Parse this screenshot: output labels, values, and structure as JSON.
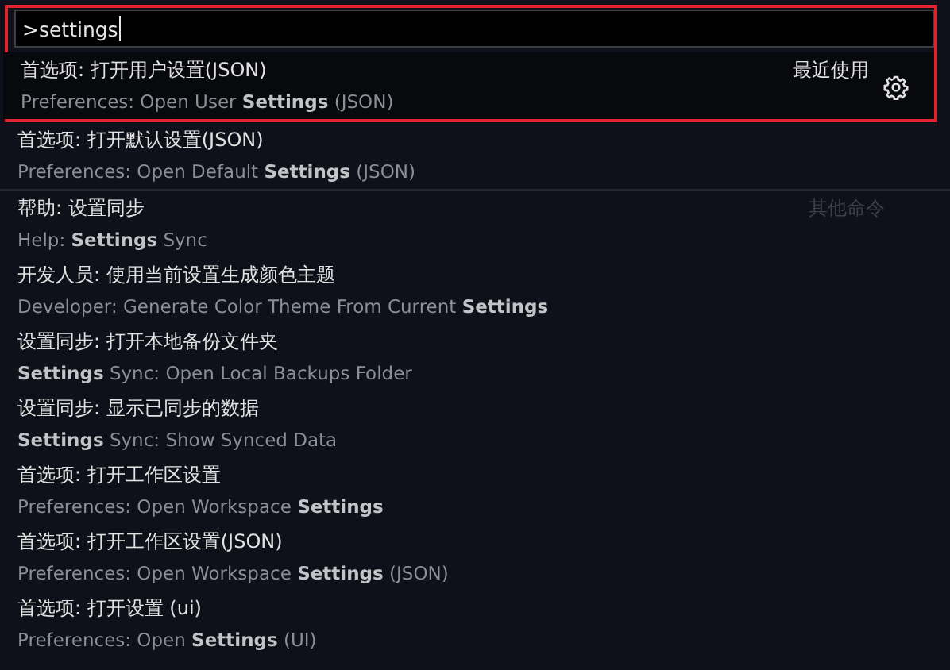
{
  "search": {
    "value": ">settings"
  },
  "items": [
    {
      "title": "首选项: 打开用户设置(JSON)",
      "detail": "Preferences: Open User **Settings** (JSON)",
      "label": "最近使用",
      "selected": true,
      "separator": false
    },
    {
      "title": "首选项: 打开默认设置(JSON)",
      "detail": "Preferences: Open Default **Settings** (JSON)",
      "selected": false,
      "separator": false
    },
    {
      "title": "帮助: 设置同步",
      "detail": "Help: **Settings** Sync",
      "label": "其他命令",
      "selected": false,
      "separator": true
    },
    {
      "title": "开发人员: 使用当前设置生成颜色主题",
      "detail": "Developer: Generate Color Theme From Current **Settings**",
      "selected": false,
      "separator": false
    },
    {
      "title": "设置同步: 打开本地备份文件夹",
      "detail": "**Settings** Sync: Open Local Backups Folder",
      "selected": false,
      "separator": false
    },
    {
      "title": "设置同步: 显示已同步的数据",
      "detail": "**Settings** Sync: Show Synced Data",
      "selected": false,
      "separator": false
    },
    {
      "title": "首选项: 打开工作区设置",
      "detail": "Preferences: Open Workspace **Settings**",
      "selected": false,
      "separator": false
    },
    {
      "title": "首选项: 打开工作区设置(JSON)",
      "detail": "Preferences: Open Workspace **Settings** (JSON)",
      "selected": false,
      "separator": false
    },
    {
      "title": "首选项: 打开设置 (ui)",
      "detail": "Preferences: Open **Settings** (UI)",
      "selected": false,
      "separator": false
    }
  ]
}
